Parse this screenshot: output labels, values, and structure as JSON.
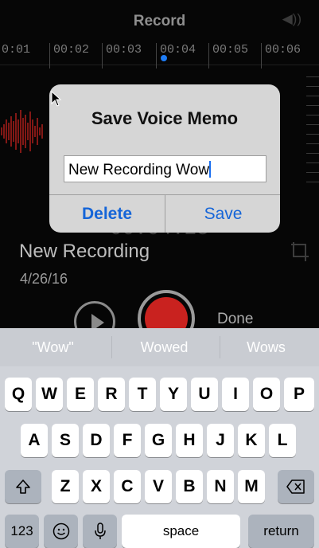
{
  "header": {
    "title": "Record"
  },
  "timeline": {
    "ticks": [
      "0:01",
      "00:02",
      "00:03",
      "00:04",
      "00:05",
      "00:06"
    ]
  },
  "recording": {
    "time": "00:04.25",
    "name": "New Recording",
    "date": "4/26/16",
    "done_label": "Done"
  },
  "alert": {
    "title": "Save Voice Memo",
    "input_value": "New Recording Wow",
    "delete_label": "Delete",
    "save_label": "Save"
  },
  "keyboard": {
    "suggestions": [
      "\"Wow\"",
      "Wowed",
      "Wows"
    ],
    "row1": [
      "Q",
      "W",
      "E",
      "R",
      "T",
      "Y",
      "U",
      "I",
      "O",
      "P"
    ],
    "row2": [
      "A",
      "S",
      "D",
      "F",
      "G",
      "H",
      "J",
      "K",
      "L"
    ],
    "row3": [
      "Z",
      "X",
      "C",
      "V",
      "B",
      "N",
      "M"
    ],
    "numbers_label": "123",
    "space_label": "space",
    "return_label": "return"
  },
  "colors": {
    "accent": "#1565d8",
    "record_red": "#c9221f",
    "playhead": "#1e7cf5"
  }
}
